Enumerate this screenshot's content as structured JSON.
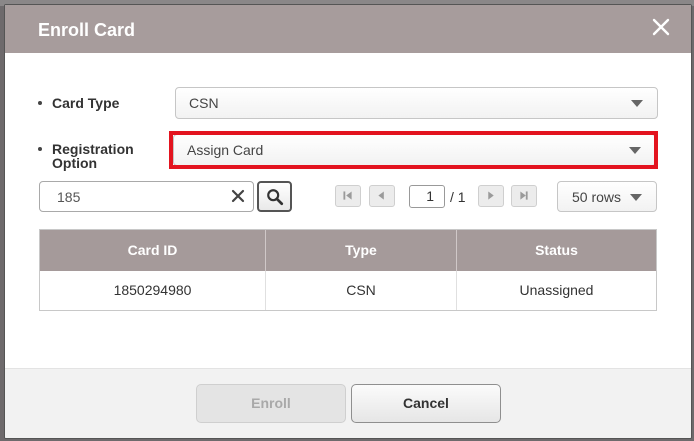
{
  "dialog": {
    "title": "Enroll Card"
  },
  "form": {
    "card_type_label": "Card Type",
    "card_type_value": "CSN",
    "registration_label_line1": "Registration",
    "registration_label_line2": "Option",
    "registration_value": "Assign Card"
  },
  "search": {
    "value": "185"
  },
  "pagination": {
    "current_page": "1",
    "total_label": "/ 1",
    "rows_per_page": "50 rows"
  },
  "table": {
    "headers": [
      "Card ID",
      "Type",
      "Status"
    ],
    "rows": [
      [
        "1850294980",
        "CSN",
        "Unassigned"
      ]
    ]
  },
  "footer": {
    "enroll_label": "Enroll",
    "cancel_label": "Cancel"
  },
  "colors": {
    "titlebar": "#a79c9c",
    "table_header": "#a59a9a",
    "highlight": "#e3141f"
  },
  "icons": [
    "close-icon",
    "clear-icon",
    "search-icon",
    "first-page-icon",
    "prev-page-icon",
    "next-page-icon",
    "last-page-icon",
    "chevron-down-icon"
  ]
}
